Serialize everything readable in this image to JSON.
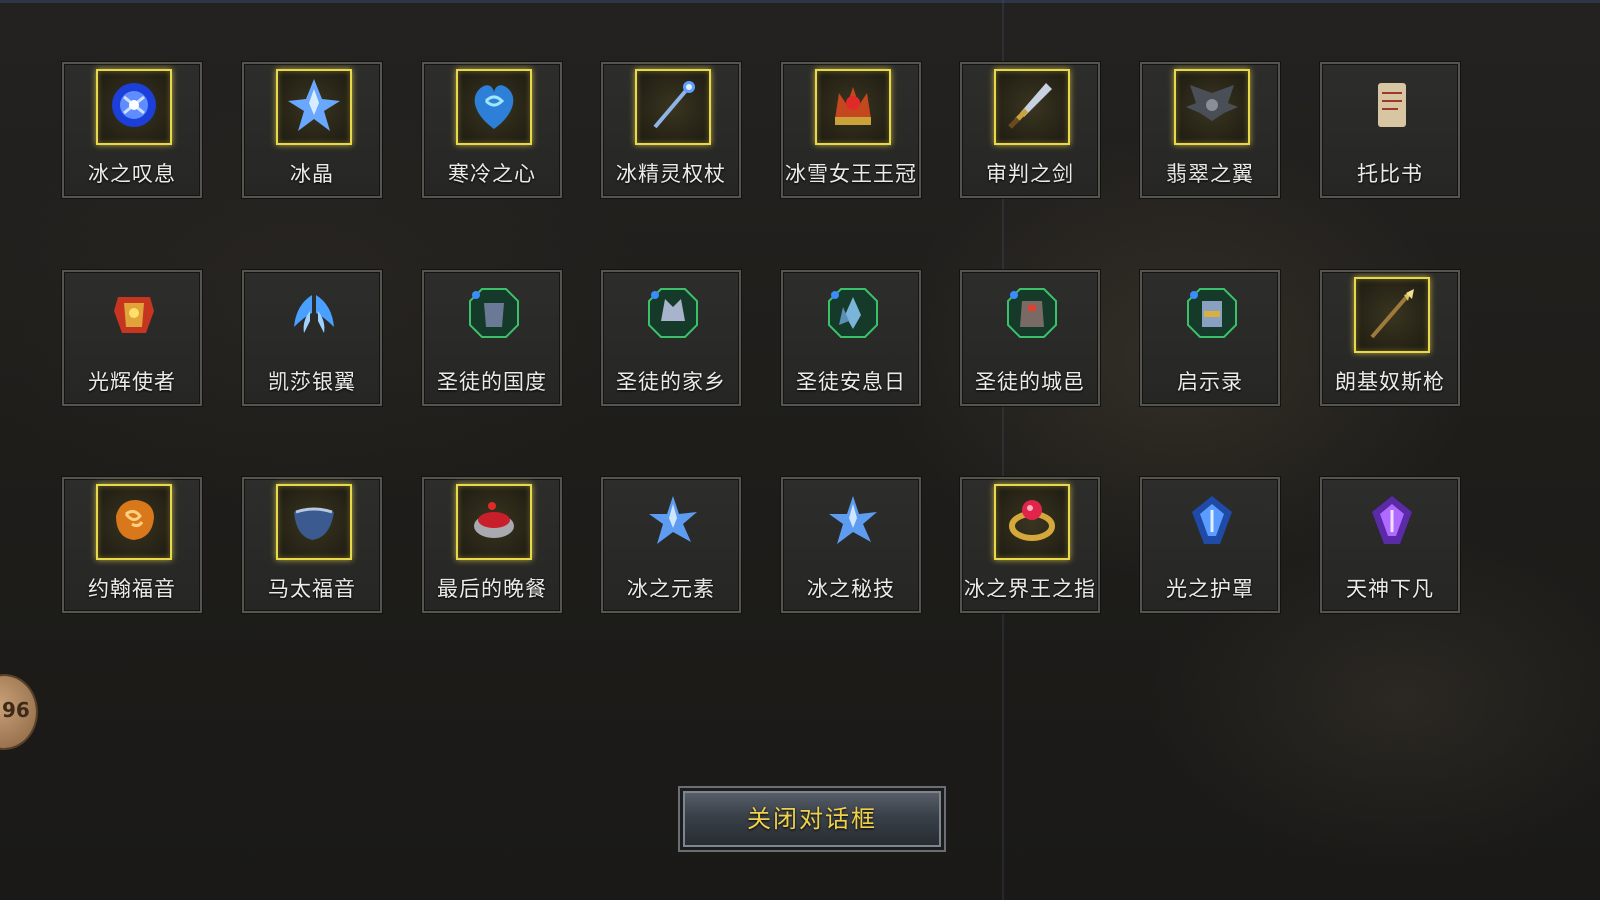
{
  "items": [
    {
      "label": "冰之叹息",
      "rare": true,
      "icon": "blue-orb-icon"
    },
    {
      "label": "冰晶",
      "rare": true,
      "icon": "ice-crystal-icon"
    },
    {
      "label": "寒冷之心",
      "rare": true,
      "icon": "frost-heart-icon"
    },
    {
      "label": "冰精灵权杖",
      "rare": true,
      "icon": "staff-icon"
    },
    {
      "label": "冰雪女王王冠",
      "rare": true,
      "icon": "crown-icon"
    },
    {
      "label": "审判之剑",
      "rare": true,
      "icon": "sword-icon"
    },
    {
      "label": "翡翠之翼",
      "rare": true,
      "icon": "dark-wings-icon"
    },
    {
      "label": "托比书",
      "rare": false,
      "icon": "scroll-icon"
    },
    {
      "label": "光辉使者",
      "rare": false,
      "icon": "golden-armor-icon"
    },
    {
      "label": "凯莎银翼",
      "rare": false,
      "icon": "silver-wings-icon"
    },
    {
      "label": "圣徒的国度",
      "rare": false,
      "icon": "saint-armor-icon"
    },
    {
      "label": "圣徒的家乡",
      "rare": false,
      "icon": "saint-helmet-icon"
    },
    {
      "label": "圣徒安息日",
      "rare": false,
      "icon": "saint-crystal-icon"
    },
    {
      "label": "圣徒的城邑",
      "rare": false,
      "icon": "saint-warrior-icon"
    },
    {
      "label": "启示录",
      "rare": false,
      "icon": "saint-knight-icon"
    },
    {
      "label": "朗基奴斯枪",
      "rare": true,
      "icon": "spear-icon"
    },
    {
      "label": "约翰福音",
      "rare": true,
      "icon": "amber-rune-icon"
    },
    {
      "label": "马太福音",
      "rare": true,
      "icon": "blue-pouch-icon"
    },
    {
      "label": "最后的晚餐",
      "rare": true,
      "icon": "blood-bowl-icon"
    },
    {
      "label": "冰之元素",
      "rare": false,
      "icon": "ice-shard-icon"
    },
    {
      "label": "冰之秘技",
      "rare": false,
      "icon": "ice-shard-icon"
    },
    {
      "label": "冰之界王之指",
      "rare": true,
      "icon": "ruby-ring-icon"
    },
    {
      "label": "光之护罩",
      "rare": false,
      "icon": "blue-shield-icon"
    },
    {
      "label": "天神下凡",
      "rare": false,
      "icon": "purple-shield-icon"
    }
  ],
  "close_button": {
    "label": "关闭对话框"
  },
  "level_badge": {
    "value": "96"
  },
  "colors": {
    "rare_frame": "#e8d84a",
    "button_text": "#f0d24a",
    "label_text": "#ecebe6"
  }
}
